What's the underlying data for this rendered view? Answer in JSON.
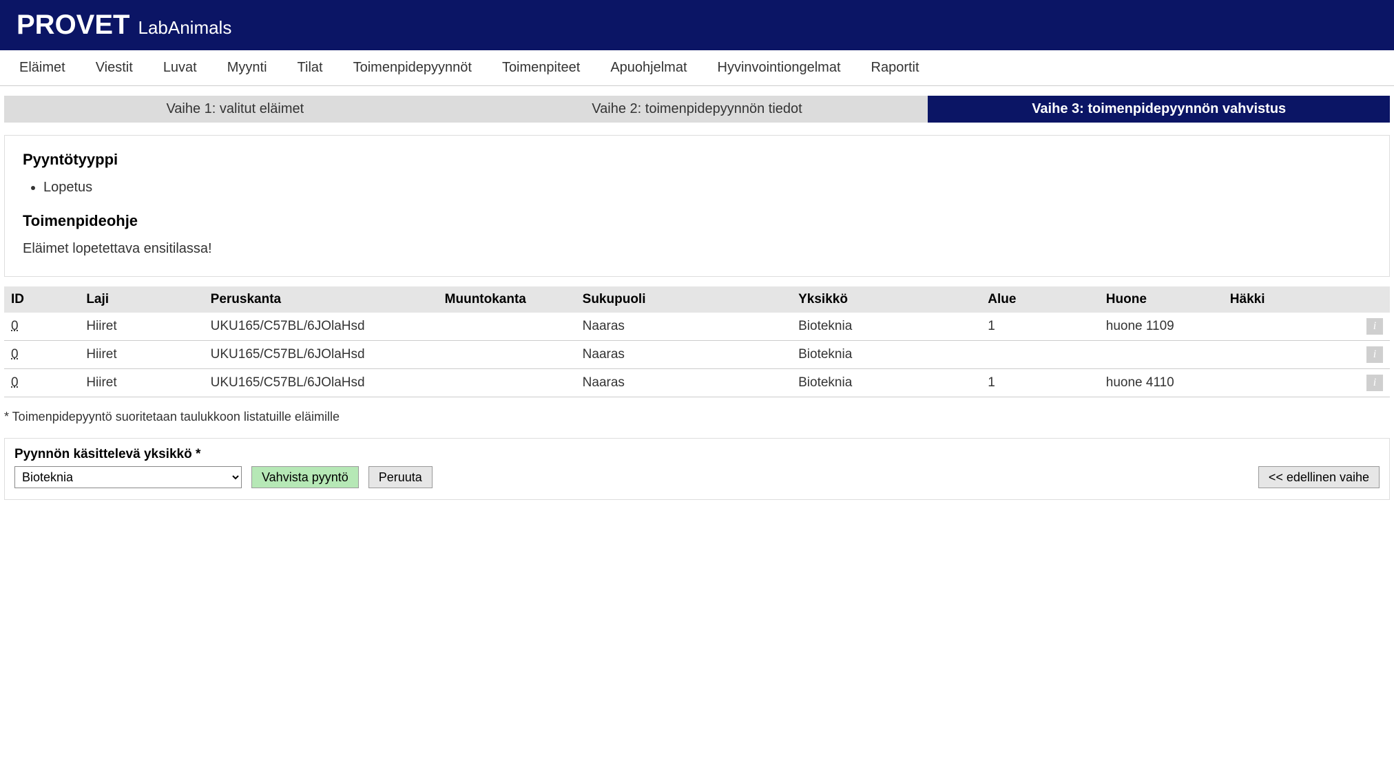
{
  "header": {
    "brand": "PROVET",
    "subtitle": "LabAnimals"
  },
  "nav": {
    "items": [
      "Eläimet",
      "Viestit",
      "Luvat",
      "Myynti",
      "Tilat",
      "Toimenpidepyynnöt",
      "Toimenpiteet",
      "Apuohjelmat",
      "Hyvinvointiongelmat",
      "Raportit"
    ]
  },
  "steps": {
    "s1": "Vaihe 1: valitut eläimet",
    "s2": "Vaihe 2: toimenpidepyynnön tiedot",
    "s3": "Vaihe 3: toimenpidepyynnön vahvistus"
  },
  "request": {
    "type_heading": "Pyyntötyyppi",
    "type_value": "Lopetus",
    "instruction_heading": "Toimenpideohje",
    "instruction_text": "Eläimet lopetettava ensitilassa!"
  },
  "table": {
    "headers": {
      "id": "ID",
      "species": "Laji",
      "strain": "Peruskanta",
      "mutstrain": "Muuntokanta",
      "sex": "Sukupuoli",
      "unit": "Yksikkö",
      "area": "Alue",
      "room": "Huone",
      "cage": "Häkki"
    },
    "rows": [
      {
        "id": "0",
        "species": "Hiiret",
        "strain": "UKU165/C57BL/6JOlaHsd",
        "mutstrain": "",
        "sex": "Naaras",
        "unit": "Bioteknia",
        "area": "1",
        "room": "huone 1109",
        "cage": ""
      },
      {
        "id": "0",
        "species": "Hiiret",
        "strain": "UKU165/C57BL/6JOlaHsd",
        "mutstrain": "",
        "sex": "Naaras",
        "unit": "Bioteknia",
        "area": "",
        "room": "",
        "cage": ""
      },
      {
        "id": "0",
        "species": "Hiiret",
        "strain": "UKU165/C57BL/6JOlaHsd",
        "mutstrain": "",
        "sex": "Naaras",
        "unit": "Bioteknia",
        "area": "1",
        "room": "huone 4110",
        "cage": ""
      }
    ]
  },
  "footnote": "* Toimenpidepyyntö suoritetaan taulukkoon listatuille eläimille",
  "form": {
    "unit_label": "Pyynnön käsittelevä yksikkö *",
    "unit_value": "Bioteknia",
    "confirm_label": "Vahvista pyyntö",
    "cancel_label": "Peruuta",
    "prev_label": "<< edellinen vaihe"
  }
}
